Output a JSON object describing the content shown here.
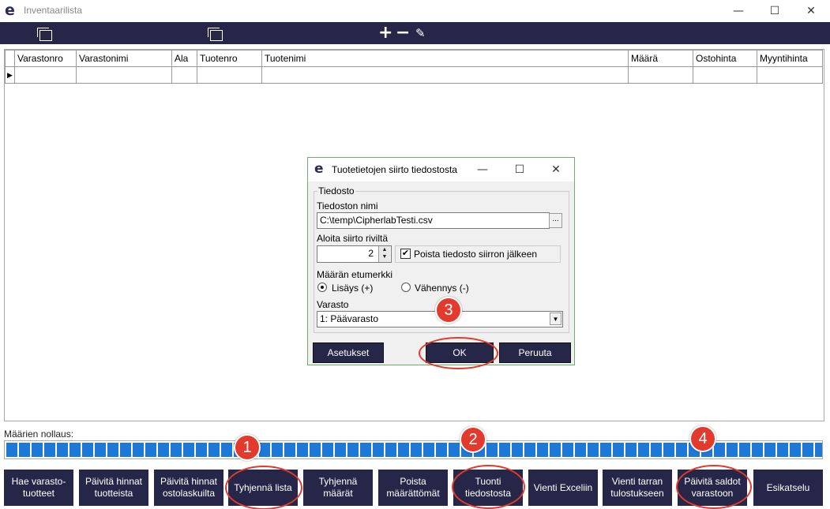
{
  "window": {
    "title": "Inventaarilista",
    "minimize": "—",
    "maximize": "☐",
    "close": "✕"
  },
  "toolbar": {
    "icons": [
      "window-icon",
      "window-icon",
      "plus-icon",
      "minus-icon",
      "brush-icon"
    ],
    "plus": "+",
    "minus": "−",
    "brush": "✎"
  },
  "grid": {
    "columns": [
      "Varastonro",
      "Varastonimi",
      "Ala",
      "Tuotenro",
      "Tuotenimi",
      "Määrä",
      "Ostohinta",
      "Myyntihinta"
    ],
    "row_indicator": "▶"
  },
  "reset": {
    "label": "Määrien nollaus:",
    "progress_percent": 100
  },
  "buttons": [
    {
      "label": "Hae varasto-\ntuotteet"
    },
    {
      "label": "Päivitä hinnat\ntuotteista"
    },
    {
      "label": "Päivitä hinnat\nostolaskuilta"
    },
    {
      "label": "Tyhjennä lista"
    },
    {
      "label": "Tyhjennä\nmäärät"
    },
    {
      "label": "Poista\nmäärättömät"
    },
    {
      "label": "Tuonti\ntiedostosta"
    },
    {
      "label": "Vienti Exceliin"
    },
    {
      "label": "Vienti tarran\ntulostukseen"
    },
    {
      "label": "Päivitä saldot\nvarastoon"
    },
    {
      "label": "Esikatselu"
    }
  ],
  "dialog": {
    "title": "Tuotetietojen siirto tiedostosta",
    "minimize": "—",
    "maximize": "☐",
    "close": "✕",
    "group_label": "Tiedosto",
    "filename_label": "Tiedoston nimi",
    "filename_value": "C:\\temp\\CipherlabTesti.csv",
    "browse": "...",
    "start_row_label": "Aloita siirto riviltä",
    "start_row_value": "2",
    "delete_file_label": "Poista tiedosto siirron jälkeen",
    "delete_file_checked": "✔",
    "sign_label": "Määrän etumerkki",
    "radio_add": "Lisäys (+)",
    "radio_sub": "Vähennys (-)",
    "warehouse_label": "Varasto",
    "warehouse_value": "1: Päävarasto",
    "settings_button": "Asetukset",
    "ok_button": "OK",
    "cancel_button": "Peruuta"
  },
  "callouts": [
    "1",
    "2",
    "3",
    "4"
  ],
  "colors": {
    "dark_navy": "#262748",
    "progress_blue": "#1e78d8",
    "callout_red": "#e23a2d"
  }
}
